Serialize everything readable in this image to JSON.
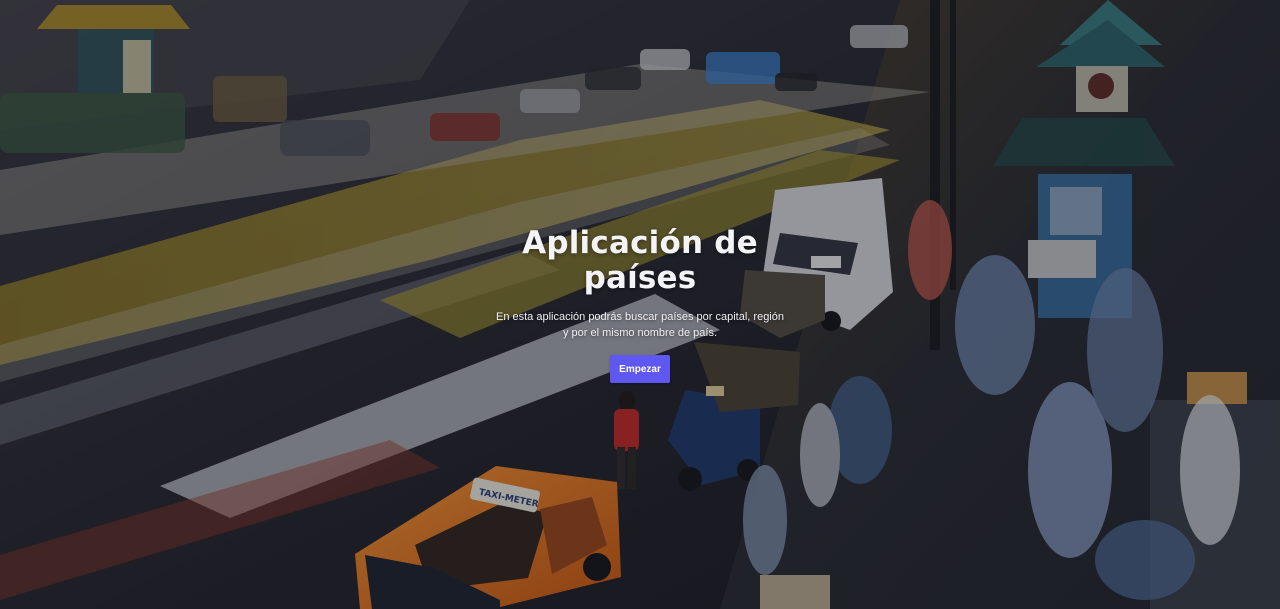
{
  "hero": {
    "title": "Aplicación de países",
    "description": "En esta aplicación podrás buscar países por capital, región y por el mismo nombre de país.",
    "start_button_label": "Empezar",
    "taxi_sign": "TAXI-METER",
    "colors": {
      "accent": "#5e57f2",
      "overlay": "#0f1016",
      "taxi": "#f47a1b",
      "headline": "#f4f4f7"
    }
  }
}
